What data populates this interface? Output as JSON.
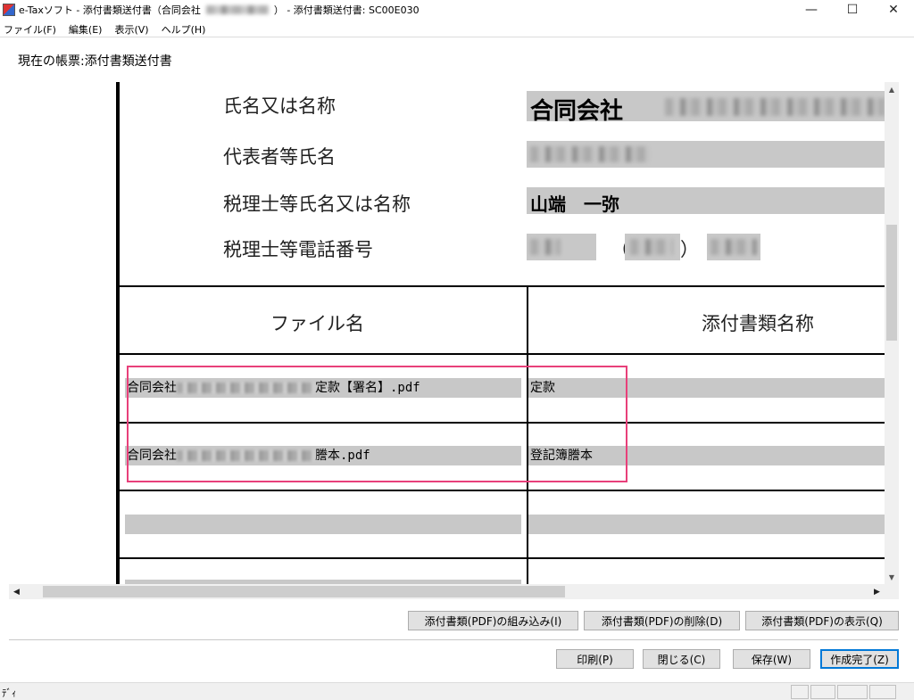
{
  "window": {
    "title": "e-Taxソフト - 添付書類送付書（合同会社",
    "title_suffix": "） - 添付書類送付書: SC00E030",
    "controls": {
      "minimize": "—",
      "maximize": "☐",
      "close": "✕"
    }
  },
  "menu": [
    {
      "label": "ファイル(F)"
    },
    {
      "label": "編集(E)"
    },
    {
      "label": "表示(V)"
    },
    {
      "label": "ヘルプ(H)"
    }
  ],
  "current_form": "現在の帳票:添付書類送付書",
  "info": {
    "name_label": "氏名又は名称",
    "name_value": "合同会社",
    "representative_label": "代表者等氏名",
    "tax_accountant_label": "税理士等氏名又は名称",
    "tax_accountant_value": "山端　一弥",
    "phone_label": "税理士等電話番号",
    "phone_open": "（",
    "phone_close": "）"
  },
  "table": {
    "headers": {
      "file_name": "ファイル名",
      "doc_name": "添付書類名称"
    },
    "rows": [
      {
        "file_prefix": "合同会社",
        "file_suffix": "定款【署名】.pdf",
        "doc": "定款"
      },
      {
        "file_prefix": "合同会社",
        "file_suffix": "謄本.pdf",
        "doc": "登記簿謄本"
      },
      {
        "file_prefix": "",
        "file_suffix": "",
        "doc": ""
      }
    ]
  },
  "pdf_buttons": {
    "embed": "添付書類(PDF)の組み込み(I)",
    "delete": "添付書類(PDF)の削除(D)",
    "show": "添付書類(PDF)の表示(Q)"
  },
  "action_buttons": {
    "print": "印刷(P)",
    "close": "閉じる(C)",
    "save": "保存(W)",
    "complete": "作成完了(Z)"
  },
  "status": {
    "text": "ﾃﾞｨ"
  },
  "colors": {
    "highlight": "#e8407a",
    "field_gray": "#c8c8c8",
    "default_button_border": "#0078d7"
  }
}
